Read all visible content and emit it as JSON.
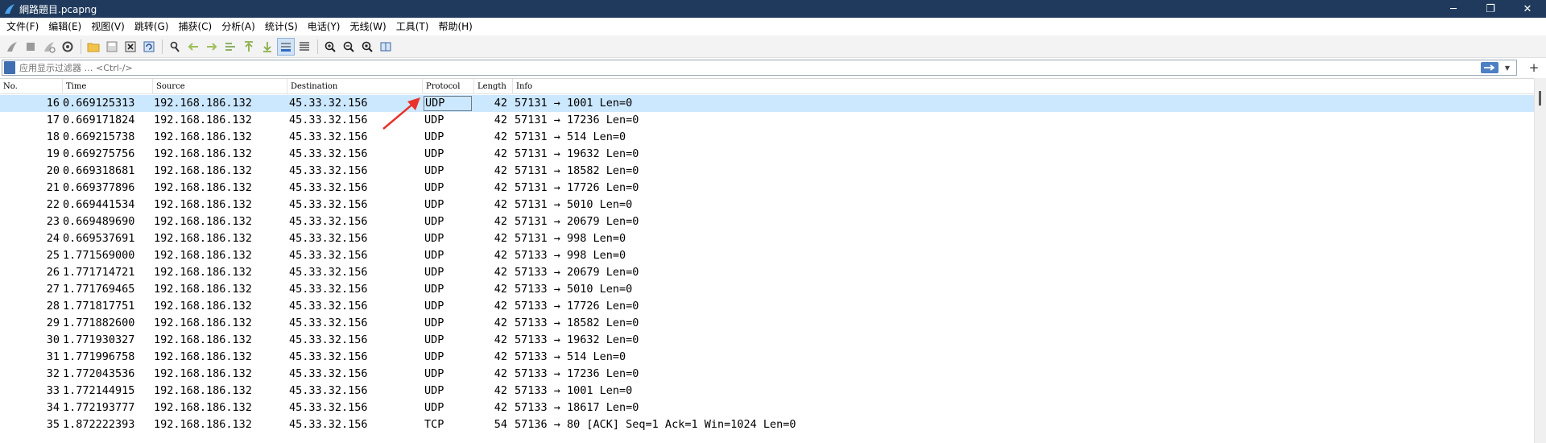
{
  "window": {
    "title": "網路題目.pcapng",
    "controls": [
      "─",
      "❐",
      "✕"
    ]
  },
  "menu": [
    "文件(F)",
    "编辑(E)",
    "视图(V)",
    "跳转(G)",
    "捕获(C)",
    "分析(A)",
    "统计(S)",
    "电话(Y)",
    "无线(W)",
    "工具(T)",
    "帮助(H)"
  ],
  "toolbar": {
    "icons": [
      "shark-fin-start-icon",
      "stop-square-icon",
      "restart-fin-icon",
      "gear-options-icon",
      "folder-open-icon",
      "file-save-icon",
      "file-close-icon",
      "reload-icon",
      "find-magnifier-icon",
      "go-back-arrow-icon",
      "go-forward-arrow-icon",
      "go-to-packet-icon",
      "go-first-icon",
      "go-last-icon",
      "autoscroll-icon",
      "colorize-icon",
      "zoom-in-icon",
      "zoom-out-icon",
      "zoom-normal-icon",
      "resize-columns-icon"
    ]
  },
  "filter": {
    "placeholder": "应用显示过滤器 … <Ctrl-/>"
  },
  "columns": {
    "no": "No.",
    "time": "Time",
    "source": "Source",
    "destination": "Destination",
    "protocol": "Protocol",
    "length": "Length",
    "info": "Info"
  },
  "packets": [
    {
      "no": "16",
      "time": "0.669125313",
      "source": "192.168.186.132",
      "destination": "45.33.32.156",
      "protocol": "UDP",
      "length": "42",
      "info": "57131 → 1001 Len=0"
    },
    {
      "no": "17",
      "time": "0.669171824",
      "source": "192.168.186.132",
      "destination": "45.33.32.156",
      "protocol": "UDP",
      "length": "42",
      "info": "57131 → 17236 Len=0"
    },
    {
      "no": "18",
      "time": "0.669215738",
      "source": "192.168.186.132",
      "destination": "45.33.32.156",
      "protocol": "UDP",
      "length": "42",
      "info": "57131 → 514 Len=0"
    },
    {
      "no": "19",
      "time": "0.669275756",
      "source": "192.168.186.132",
      "destination": "45.33.32.156",
      "protocol": "UDP",
      "length": "42",
      "info": "57131 → 19632 Len=0"
    },
    {
      "no": "20",
      "time": "0.669318681",
      "source": "192.168.186.132",
      "destination": "45.33.32.156",
      "protocol": "UDP",
      "length": "42",
      "info": "57131 → 18582 Len=0"
    },
    {
      "no": "21",
      "time": "0.669377896",
      "source": "192.168.186.132",
      "destination": "45.33.32.156",
      "protocol": "UDP",
      "length": "42",
      "info": "57131 → 17726 Len=0"
    },
    {
      "no": "22",
      "time": "0.669441534",
      "source": "192.168.186.132",
      "destination": "45.33.32.156",
      "protocol": "UDP",
      "length": "42",
      "info": "57131 → 5010 Len=0"
    },
    {
      "no": "23",
      "time": "0.669489690",
      "source": "192.168.186.132",
      "destination": "45.33.32.156",
      "protocol": "UDP",
      "length": "42",
      "info": "57131 → 20679 Len=0"
    },
    {
      "no": "24",
      "time": "0.669537691",
      "source": "192.168.186.132",
      "destination": "45.33.32.156",
      "protocol": "UDP",
      "length": "42",
      "info": "57131 → 998 Len=0"
    },
    {
      "no": "25",
      "time": "1.771569000",
      "source": "192.168.186.132",
      "destination": "45.33.32.156",
      "protocol": "UDP",
      "length": "42",
      "info": "57133 → 998 Len=0"
    },
    {
      "no": "26",
      "time": "1.771714721",
      "source": "192.168.186.132",
      "destination": "45.33.32.156",
      "protocol": "UDP",
      "length": "42",
      "info": "57133 → 20679 Len=0"
    },
    {
      "no": "27",
      "time": "1.771769465",
      "source": "192.168.186.132",
      "destination": "45.33.32.156",
      "protocol": "UDP",
      "length": "42",
      "info": "57133 → 5010 Len=0"
    },
    {
      "no": "28",
      "time": "1.771817751",
      "source": "192.168.186.132",
      "destination": "45.33.32.156",
      "protocol": "UDP",
      "length": "42",
      "info": "57133 → 17726 Len=0"
    },
    {
      "no": "29",
      "time": "1.771882600",
      "source": "192.168.186.132",
      "destination": "45.33.32.156",
      "protocol": "UDP",
      "length": "42",
      "info": "57133 → 18582 Len=0"
    },
    {
      "no": "30",
      "time": "1.771930327",
      "source": "192.168.186.132",
      "destination": "45.33.32.156",
      "protocol": "UDP",
      "length": "42",
      "info": "57133 → 19632 Len=0"
    },
    {
      "no": "31",
      "time": "1.771996758",
      "source": "192.168.186.132",
      "destination": "45.33.32.156",
      "protocol": "UDP",
      "length": "42",
      "info": "57133 → 514 Len=0"
    },
    {
      "no": "32",
      "time": "1.772043536",
      "source": "192.168.186.132",
      "destination": "45.33.32.156",
      "protocol": "UDP",
      "length": "42",
      "info": "57133 → 17236 Len=0"
    },
    {
      "no": "33",
      "time": "1.772144915",
      "source": "192.168.186.132",
      "destination": "45.33.32.156",
      "protocol": "UDP",
      "length": "42",
      "info": "57133 → 1001 Len=0"
    },
    {
      "no": "34",
      "time": "1.772193777",
      "source": "192.168.186.132",
      "destination": "45.33.32.156",
      "protocol": "UDP",
      "length": "42",
      "info": "57133 → 18617 Len=0"
    },
    {
      "no": "35",
      "time": "1.872222393",
      "source": "192.168.186.132",
      "destination": "45.33.32.156",
      "protocol": "TCP",
      "length": "54",
      "info": "57136 → 80 [ACK] Seq=1 Ack=1 Win=1024 Len=0"
    }
  ],
  "selected_row": 0,
  "colors": {
    "titlebar": "#1f3a5c",
    "selected_row": "#cce8ff",
    "annotation_arrow": "#e8322b"
  }
}
